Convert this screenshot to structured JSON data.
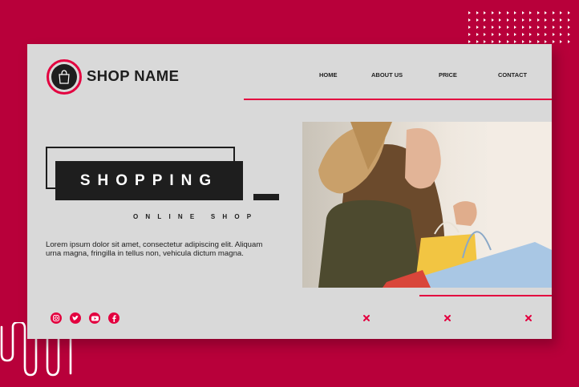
{
  "header": {
    "shop_name": "SHOP NAME",
    "nav": [
      "HOME",
      "ABOUT US",
      "PRICE",
      "CONTACT"
    ]
  },
  "hero": {
    "title": "SHOPPING",
    "subtitle": "ONLINE SHOP",
    "body": "Lorem ipsum dolor sit amet, consectetur adipiscing elit. Aliquam urna magna, fringilla in tellus non, vehicula dictum magna."
  },
  "social_icons": [
    "instagram-icon",
    "twitter-icon",
    "youtube-icon",
    "facebook-icon"
  ],
  "colors": {
    "background": "#b8003a",
    "accent": "#e3003f",
    "card": "#d9d9d9",
    "dark": "#1e1e1e"
  }
}
